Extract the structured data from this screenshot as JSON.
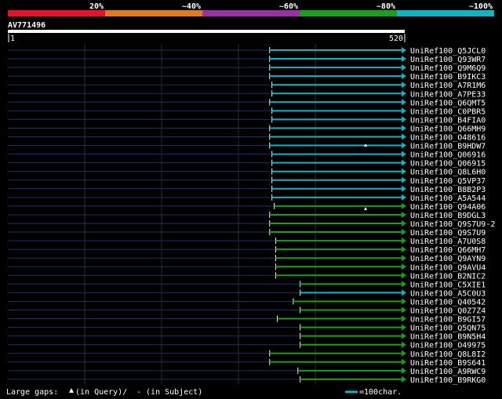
{
  "identity_scale": {
    "labels": [
      "20%",
      "~40%",
      "~60%",
      "~80%",
      "~100%"
    ],
    "colors": [
      "#e8102a",
      "#e37b1d",
      "#9a2fa8",
      "#18a018",
      "#11b3c6"
    ]
  },
  "query": {
    "id": "AV771496",
    "length_start": "1",
    "length_end": "520"
  },
  "hits": [
    {
      "name": "UniRef100_Q5JCL0",
      "start": 343,
      "identity": "~100%"
    },
    {
      "name": "UniRef100_Q93WR7",
      "start": 343,
      "identity": "~100%"
    },
    {
      "name": "UniRef100_Q9M6Q9",
      "start": 343,
      "identity": "~100%"
    },
    {
      "name": "UniRef100_B9IKC3",
      "start": 343,
      "identity": "~100%"
    },
    {
      "name": "UniRef100_A7R1M6",
      "start": 346,
      "identity": "~100%"
    },
    {
      "name": "UniRef100_A7PE33",
      "start": 346,
      "identity": "~100%"
    },
    {
      "name": "UniRef100_Q6QMT5",
      "start": 343,
      "identity": "~100%"
    },
    {
      "name": "UniRef100_C0PBR5",
      "start": 346,
      "identity": "~100%"
    },
    {
      "name": "UniRef100_B4FIA0",
      "start": 346,
      "identity": "~100%"
    },
    {
      "name": "UniRef100_Q66MH9",
      "start": 343,
      "identity": "~100%"
    },
    {
      "name": "UniRef100_O48616",
      "start": 343,
      "identity": "~100%"
    },
    {
      "name": "UniRef100_B9HDW7",
      "start": 343,
      "identity": "~100%"
    },
    {
      "name": "UniRef100_Q06916",
      "start": 346,
      "identity": "~100%"
    },
    {
      "name": "UniRef100_Q06915",
      "start": 346,
      "identity": "~100%"
    },
    {
      "name": "UniRef100_Q8L6H0",
      "start": 346,
      "identity": "~100%"
    },
    {
      "name": "UniRef100_Q5VP37",
      "start": 346,
      "identity": "~100%"
    },
    {
      "name": "UniRef100_B8B2P3",
      "start": 346,
      "identity": "~100%"
    },
    {
      "name": "UniRef100_A5A544",
      "start": 346,
      "identity": "~100%"
    },
    {
      "name": "UniRef100_Q94A06",
      "start": 349,
      "identity": "~80%"
    },
    {
      "name": "UniRef100_B9DGL3",
      "start": 343,
      "identity": "~80%"
    },
    {
      "name": "UniRef100_Q9S7U9-2",
      "start": 343,
      "identity": "~80%"
    },
    {
      "name": "UniRef100_Q9S7U9",
      "start": 343,
      "identity": "~80%"
    },
    {
      "name": "UniRef100_A7U0S8",
      "start": 351,
      "identity": "~80%"
    },
    {
      "name": "UniRef100_Q66MH7",
      "start": 351,
      "identity": "~80%"
    },
    {
      "name": "UniRef100_Q9AYN9",
      "start": 351,
      "identity": "~80%"
    },
    {
      "name": "UniRef100_Q9AVU4",
      "start": 351,
      "identity": "~80%"
    },
    {
      "name": "UniRef100_B2NIC2",
      "start": 351,
      "identity": "~80%"
    },
    {
      "name": "UniRef100_C5XIE1",
      "start": 383,
      "identity": "~80%"
    },
    {
      "name": "UniRef100_A5C0U3",
      "start": 383,
      "identity": "~100%"
    },
    {
      "name": "UniRef100_Q40542",
      "start": 374,
      "identity": "~80%"
    },
    {
      "name": "UniRef100_Q0Z7Z4",
      "start": 383,
      "identity": "~80%"
    },
    {
      "name": "UniRef100_B9GI57",
      "start": 353,
      "identity": "~80%"
    },
    {
      "name": "UniRef100_Q5QN75",
      "start": 383,
      "identity": "~80%"
    },
    {
      "name": "UniRef100_B9N5H4",
      "start": 383,
      "identity": "~80%"
    },
    {
      "name": "UniRef100_O49975",
      "start": 383,
      "identity": "~80%"
    },
    {
      "name": "UniRef100_Q8L8I2",
      "start": 343,
      "identity": "~80%"
    },
    {
      "name": "UniRef100_B9S641",
      "start": 343,
      "identity": "~80%"
    },
    {
      "name": "UniRef100_A9RWC9",
      "start": 380,
      "identity": "~80%"
    },
    {
      "name": "UniRef100_B9RKG0",
      "start": 383,
      "identity": "~80%"
    }
  ],
  "footer": {
    "gaps_prefix": "Large gaps: ",
    "gaps_query": "(in Query)/",
    "gaps_subject": "- (in Subject)",
    "scale_note": "=100char."
  }
}
